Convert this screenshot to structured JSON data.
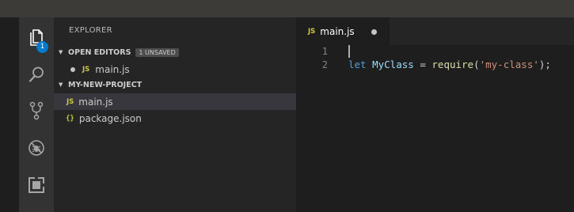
{
  "sidebar": {
    "title": "EXPLORER",
    "open_editors": {
      "label": "OPEN EDITORS",
      "unsaved_badge": "1 UNSAVED",
      "files": [
        {
          "icon_text": "JS",
          "name": "main.js",
          "unsaved": true
        }
      ]
    },
    "project": {
      "label": "MY-NEW-PROJECT",
      "files": [
        {
          "icon_text": "JS",
          "name": "main.js",
          "active": true
        },
        {
          "icon_text": "{}",
          "name": "package.json"
        }
      ]
    }
  },
  "activity": {
    "items": [
      "files-icon",
      "search-icon",
      "source-control-icon",
      "debug-icon",
      "extensions-icon"
    ],
    "explorer_badge": "1"
  },
  "tabs": [
    {
      "icon_text": "JS",
      "name": "main.js",
      "dirty": true
    }
  ],
  "editor": {
    "line_numbers": [
      "1",
      "2"
    ],
    "lines": [
      "",
      "let MyClass = require('my-class');"
    ]
  },
  "colors": {
    "accent": "#007acc",
    "js_icon": "#cbcb41",
    "keyword": "#569cd6",
    "variable": "#9cdcfe",
    "function": "#dcdcaa",
    "string": "#ce9178",
    "text": "#d4d4d4"
  }
}
